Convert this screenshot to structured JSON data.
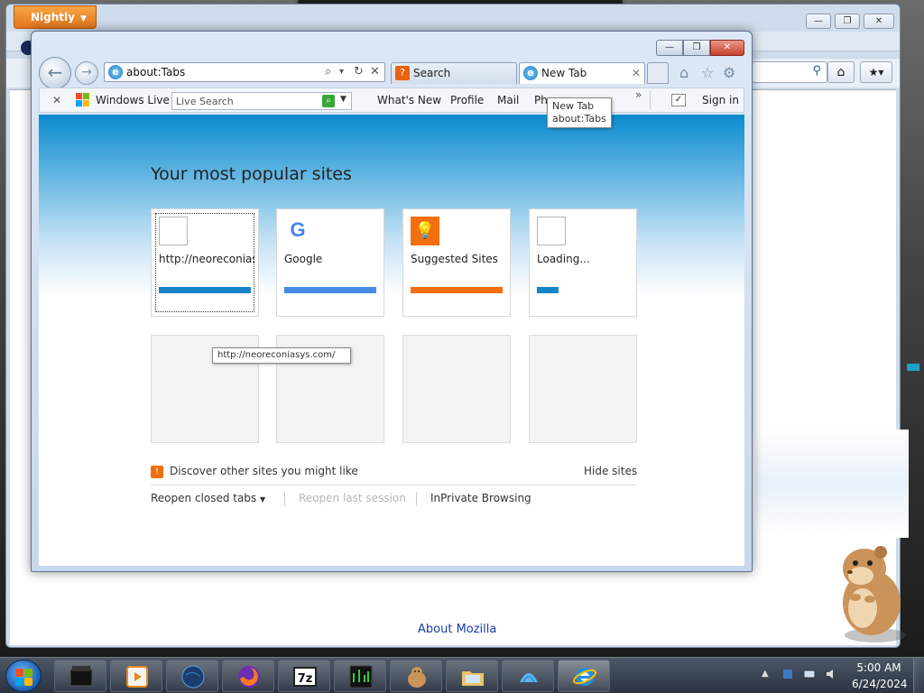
{
  "firefox": {
    "menu_button": "Nightly",
    "menu_caret": "▼",
    "about_link": "About Mozilla",
    "min_glyph": "—",
    "max_glyph": "❐",
    "close_glyph": "✕",
    "search_icon": "magnifier-icon",
    "home_icon": "⌂",
    "bookmark_icon": "★▾"
  },
  "ie": {
    "win_min": "—",
    "win_max": "❐",
    "win_close": "✕",
    "back_glyph": "←",
    "fwd_glyph": "→",
    "address": "about:Tabs",
    "address_tools": {
      "search": "⌕",
      "dropdown": "▾",
      "refresh": "↻",
      "stop": "✕"
    },
    "tabs": [
      {
        "label": "Search",
        "icon": "search-tab-icon"
      },
      {
        "label": "New Tab",
        "icon": "ie-logo-icon",
        "close": "✕"
      }
    ],
    "command_icons": {
      "home": "⌂",
      "favorites": "☆",
      "tools": "⚙"
    },
    "command_bar": {
      "close": "✕",
      "windows_live": "Windows Live",
      "live_search_placeholder": "Live Search",
      "live_search_go": "⌕",
      "live_search_drop": "▼",
      "links": [
        "What's New",
        "Profile",
        "Mail",
        "Pho"
      ],
      "more": "»",
      "sign_in_check": "✓",
      "sign_in": "Sign in"
    },
    "tab_tooltip": {
      "title": "New Tab",
      "url": "about:Tabs"
    }
  },
  "new_tab_page": {
    "heading": "Your most popular sites",
    "tiles": [
      {
        "title": "http://neoreconiasys.com/",
        "bar_color": "#1684c6",
        "bar_fill": 1.0,
        "kind": "blank"
      },
      {
        "title": "Google",
        "bar_color": "#4a8ae8",
        "bar_fill": 1.0,
        "kind": "google"
      },
      {
        "title": "Suggested Sites",
        "bar_color": "#f26f0f",
        "bar_fill": 1.0,
        "kind": "suggested"
      },
      {
        "title": "Loading...",
        "bar_color": "#1684c6",
        "bar_fill": 0.24,
        "kind": "blank"
      }
    ],
    "tile_url_tooltip": "http://neoreconiasys.com/",
    "discover_text": "Discover other sites you might like",
    "hide_sites": "Hide sites",
    "reopen_closed_tabs": "Reopen closed tabs",
    "reopen_caret": "▼",
    "reopen_last_session": "Reopen last session",
    "inprivate": "InPrivate Browsing"
  },
  "taskbar": {
    "items": [
      "terminal-icon",
      "media-player-icon",
      "globe-icon",
      "firefox-icon",
      "7zip-icon",
      "task-manager-icon",
      "hamster-icon",
      "folder-icon",
      "shell-icon",
      "internet-explorer-icon"
    ],
    "seven_zip_label": "7z",
    "tray_arrow": "▲",
    "clock_time": "5:00 AM",
    "clock_date": "6/24/2024"
  }
}
